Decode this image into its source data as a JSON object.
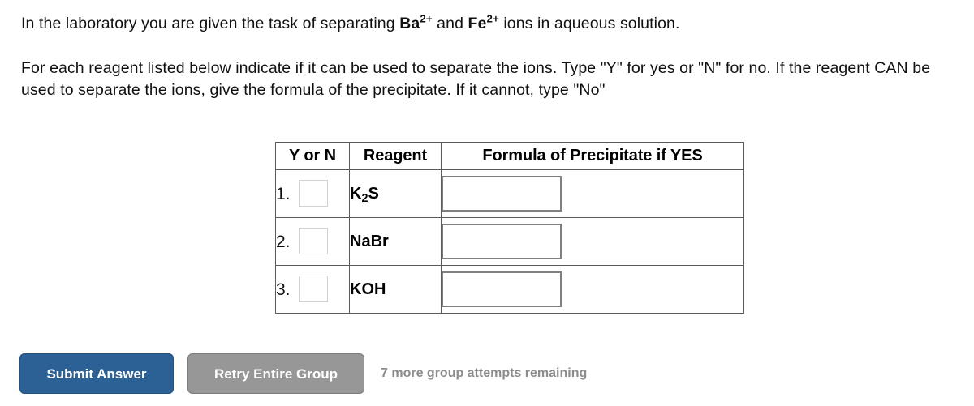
{
  "prompt": {
    "line1_before": "In the laboratory you are given the task of separating ",
    "ion1": "Ba",
    "ion1_charge": "2+",
    "line1_mid": " and ",
    "ion2": "Fe",
    "ion2_charge": "2+",
    "line1_after": " ions in aqueous solution.",
    "line2": "For each reagent listed below indicate if it can be used to separate the ions. Type \"Y\" for yes or \"N\" for no. If the reagent CAN be used to separate the ions, give the formula of the precipitate. If it cannot, type \"No\""
  },
  "table": {
    "headers": {
      "yes_or_no": "Y or N",
      "reagent": "Reagent",
      "formula": "Formula of Precipitate if YES"
    },
    "rows": [
      {
        "number": "1.",
        "yn_value": "",
        "reagent_main": "K",
        "reagent_sub": "2",
        "reagent_tail": "S",
        "formula_value": ""
      },
      {
        "number": "2.",
        "yn_value": "",
        "reagent_main": "NaBr",
        "reagent_sub": "",
        "reagent_tail": "",
        "formula_value": ""
      },
      {
        "number": "3.",
        "yn_value": "",
        "reagent_main": "KOH",
        "reagent_sub": "",
        "reagent_tail": "",
        "formula_value": ""
      }
    ]
  },
  "footer": {
    "submit_label": "Submit Answer",
    "retry_label": "Retry Entire Group",
    "attempts_text": "7 more group attempts remaining"
  },
  "colors": {
    "submit_blue": "#2b6195",
    "retry_gray": "#979797",
    "attempts_gray": "#8c8c8c",
    "table_border": "#5a5a5a",
    "input_border": "#808080"
  }
}
